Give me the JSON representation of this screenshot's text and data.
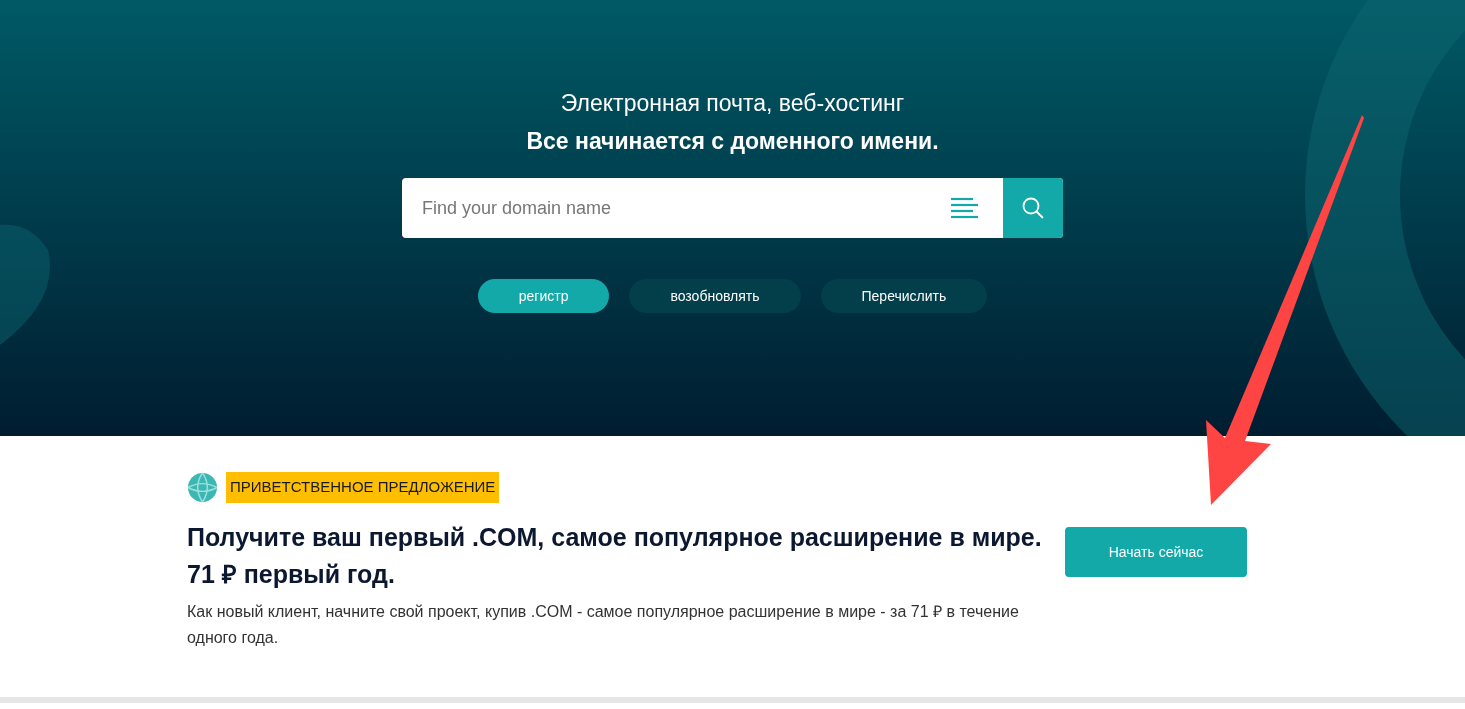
{
  "hero": {
    "title": "Электронная почта, веб-хостинг",
    "subtitle": "Все начинается с доменного имени.",
    "search": {
      "placeholder": "Find your domain name"
    },
    "tabs": [
      {
        "label": "регистр",
        "selected": true
      },
      {
        "label": "возобновлять",
        "selected": false
      },
      {
        "label": "Перечислить",
        "selected": false
      }
    ]
  },
  "offer": {
    "badge": "ПРИВЕТСТВЕННОЕ ПРЕДЛОЖЕНИЕ",
    "headline": "Получите ваш первый .COM, самое популярное расширение в мире.",
    "price_line": "71 ₽ первый год.",
    "description": "Как новый клиент, начните свой проект, купив .COM - самое популярное расширение в мире - за 71 ₽ в течение одного года.",
    "button": "Начать сейчас"
  }
}
